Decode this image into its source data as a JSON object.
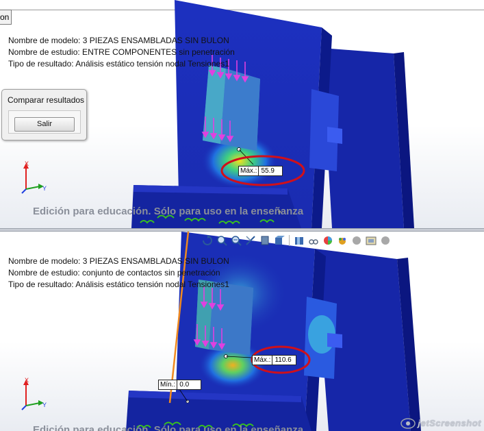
{
  "top_pane": {
    "tab_stub_label": "on",
    "info": {
      "model_name": "Nombre de modelo: 3 PIEZAS ENSAMBLADAS SIN BULON",
      "study_name": "Nombre de estudio: ENTRE COMPONENTES sin penetración",
      "result_type": "Tipo de resultado: Análisis estático tensión nodal Tensiones1"
    },
    "compare_panel": {
      "title": "Comparar resultados",
      "exit_button": "Salir"
    },
    "max_tag": {
      "label": "Máx.:",
      "value": "55.9"
    },
    "watermark": "Edición para educación. Sólo para uso en la enseñanza",
    "axes": {
      "x": "X",
      "y": "Y"
    }
  },
  "bottom_pane": {
    "info": {
      "model_name": "Nombre de modelo: 3 PIEZAS ENSAMBLADAS SIN BULON",
      "study_name": "Nombre de estudio: conjunto de contactos sin penetración",
      "result_type": "Tipo de resultado: Análisis estático tensión nodal Tensiones1"
    },
    "max_tag": {
      "label": "Máx.:",
      "value": "110.6"
    },
    "min_tag": {
      "label": "Mín.:",
      "value": "0.0"
    },
    "watermark": "Edición para educación. Sólo para uso en la enseñanza",
    "axes": {
      "x": "X",
      "y": "Y"
    },
    "toolbar_icons": [
      "rotate-icon",
      "zoom-to-fit-icon",
      "zoom-in-icon",
      "section-view-icon",
      "display-style-icon",
      "view-orientation-icon",
      "hide-show-icon",
      "appearance-icon",
      "scene-icon",
      "view-settings-icon",
      "render-icon"
    ]
  },
  "watermark_logo": "jetScreenshot",
  "colors": {
    "model_blue": "#1a2fb8",
    "model_dark_blue": "#0c1a8a",
    "highlight_circle": "#d0101a",
    "load_arrow": "#e040e0",
    "fixture_green": "#38c020",
    "tension_line": "#f08a20"
  }
}
